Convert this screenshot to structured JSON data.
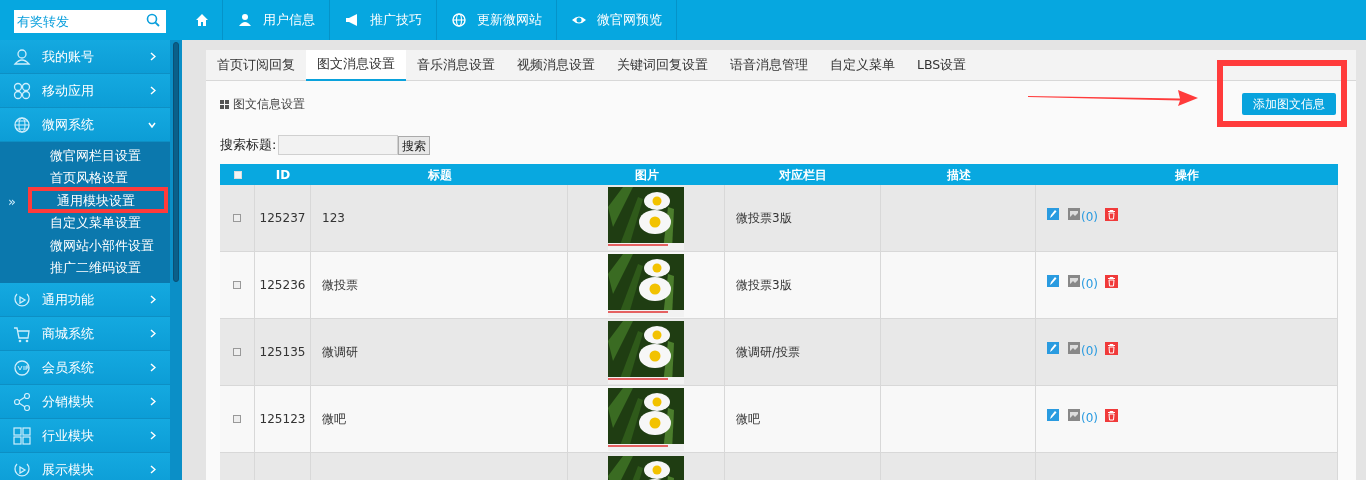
{
  "search": {
    "value": "有奖转发"
  },
  "topnav": [
    {
      "kind": "home"
    },
    {
      "kind": "link",
      "label": "用户信息"
    },
    {
      "kind": "link",
      "label": "推广技巧"
    },
    {
      "kind": "link",
      "label": "更新微网站"
    },
    {
      "kind": "link",
      "label": "微官网预览"
    }
  ],
  "sidebar": {
    "marker": "»",
    "items": [
      {
        "label": "我的账号",
        "expanded": false
      },
      {
        "label": "移动应用",
        "expanded": false
      },
      {
        "label": "微网系统",
        "expanded": true,
        "children": [
          {
            "label": "微官网栏目设置",
            "selected": false
          },
          {
            "label": "首页风格设置",
            "selected": false
          },
          {
            "label": "通用模块设置",
            "selected": true
          },
          {
            "label": "自定义菜单设置",
            "selected": false
          },
          {
            "label": "微网站小部件设置",
            "selected": false
          },
          {
            "label": "推广二维码设置",
            "selected": false
          }
        ]
      },
      {
        "label": "通用功能",
        "expanded": false
      },
      {
        "label": "商城系统",
        "expanded": false
      },
      {
        "label": "会员系统",
        "expanded": false
      },
      {
        "label": "分销模块",
        "expanded": false
      },
      {
        "label": "行业模块",
        "expanded": false
      },
      {
        "label": "展示模块",
        "expanded": false
      }
    ]
  },
  "tabs": [
    {
      "label": "首页订阅回复",
      "selected": false
    },
    {
      "label": "图文消息设置",
      "selected": true
    },
    {
      "label": "音乐消息设置",
      "selected": false
    },
    {
      "label": "视频消息设置",
      "selected": false
    },
    {
      "label": "关键词回复设置",
      "selected": false
    },
    {
      "label": "语音消息管理",
      "selected": false
    },
    {
      "label": "自定义菜单",
      "selected": false
    },
    {
      "label": "LBS设置",
      "selected": false
    }
  ],
  "section_title": "图文信息设置",
  "add_button": "添加图文信息",
  "search_form": {
    "label": "搜索标题:",
    "button": "搜索"
  },
  "table": {
    "header_checked": false,
    "columns": [
      "ID",
      "标题",
      "图片",
      "对应栏目",
      "描述",
      "操作"
    ],
    "rows": [
      {
        "kind": "full",
        "checked": false,
        "id": "125237",
        "title": "123",
        "column": "微投票3版",
        "count": "(0)"
      },
      {
        "kind": "full",
        "checked": false,
        "id": "125236",
        "title": "微投票",
        "column": "微投票3版",
        "count": "(0)"
      },
      {
        "kind": "full",
        "checked": false,
        "id": "125135",
        "title": "微调研",
        "column": "微调研/投票",
        "count": "(0)"
      },
      {
        "kind": "full",
        "checked": false,
        "id": "125123",
        "title": "微吧",
        "column": "微吧",
        "count": "(0)"
      },
      {
        "kind": "partial"
      }
    ]
  }
}
